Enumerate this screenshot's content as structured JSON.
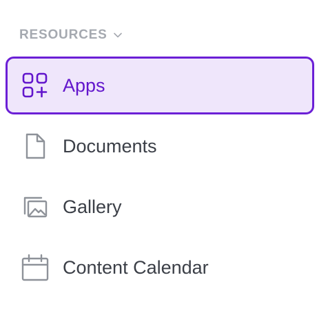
{
  "section": {
    "title": "RESOURCES",
    "chevron_icon": "chevron-down-icon"
  },
  "nav": {
    "items": [
      {
        "label": "Apps",
        "icon": "apps-grid-plus-icon",
        "active": true
      },
      {
        "label": "Documents",
        "icon": "document-icon",
        "active": false
      },
      {
        "label": "Gallery",
        "icon": "gallery-images-icon",
        "active": false
      },
      {
        "label": "Content Calendar",
        "icon": "calendar-icon",
        "active": false
      }
    ]
  },
  "colors": {
    "accent": "#6b1fd6",
    "active_background": "#efe6fb",
    "text": "#3b3f47",
    "muted": "#a5a9b0"
  }
}
